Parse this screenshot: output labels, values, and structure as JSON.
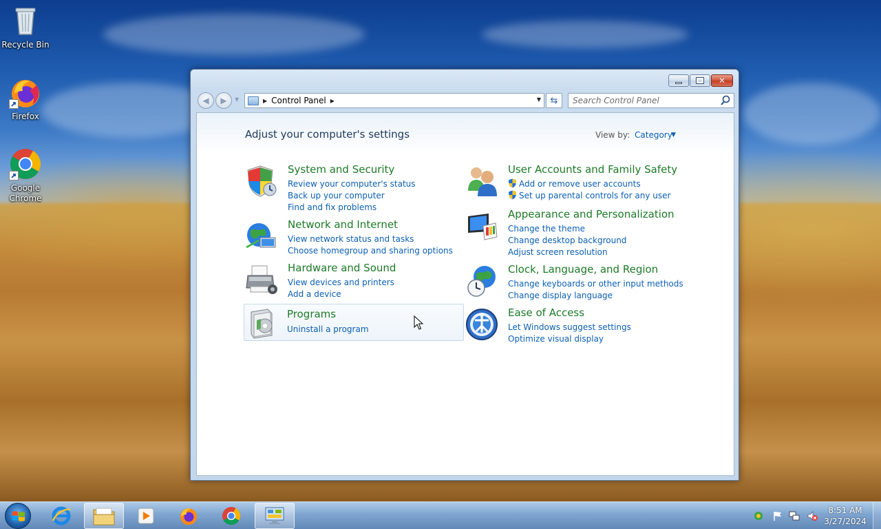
{
  "desktop": {
    "icons": [
      {
        "label": "Recycle Bin"
      },
      {
        "label": "Firefox"
      },
      {
        "label": "Google Chrome"
      }
    ]
  },
  "window": {
    "address": {
      "crumb": "Control Panel"
    },
    "search": {
      "placeholder": "Search Control Panel"
    },
    "heading": "Adjust your computer's settings",
    "view_by": {
      "label": "View by:",
      "value": "Category"
    },
    "categories": [
      {
        "title": "System and Security",
        "icon": "shield-icon",
        "links": [
          "Review your computer's status",
          "Back up your computer",
          "Find and fix problems"
        ]
      },
      {
        "title": "Network and Internet",
        "icon": "network-globe-icon",
        "links": [
          "View network status and tasks",
          "Choose homegroup and sharing options"
        ]
      },
      {
        "title": "Hardware and Sound",
        "icon": "printer-icon",
        "links": [
          "View devices and printers",
          "Add a device"
        ]
      },
      {
        "title": "Programs",
        "icon": "programs-box-icon",
        "links": [
          "Uninstall a program"
        ]
      },
      {
        "title": "User Accounts and Family Safety",
        "icon": "users-icon",
        "links": [
          "Add or remove user accounts",
          "Set up parental controls for any user"
        ]
      },
      {
        "title": "Appearance and Personalization",
        "icon": "monitor-palette-icon",
        "links": [
          "Change the theme",
          "Change desktop background",
          "Adjust screen resolution"
        ]
      },
      {
        "title": "Clock, Language, and Region",
        "icon": "clock-globe-icon",
        "links": [
          "Change keyboards or other input methods",
          "Change display language"
        ]
      },
      {
        "title": "Ease of Access",
        "icon": "ease-of-access-icon",
        "links": [
          "Let Windows suggest settings",
          "Optimize visual display"
        ]
      }
    ]
  },
  "taskbar": {
    "items": [
      "start-orb",
      "internet-explorer",
      "windows-explorer",
      "media-player",
      "firefox",
      "chrome",
      "control-panel"
    ],
    "clock": {
      "time": "8:51 AM",
      "date": "3/27/2024"
    }
  },
  "colors": {
    "link": "#0b5fb3",
    "category_title": "#1c7a26",
    "heading": "#1e395b"
  }
}
